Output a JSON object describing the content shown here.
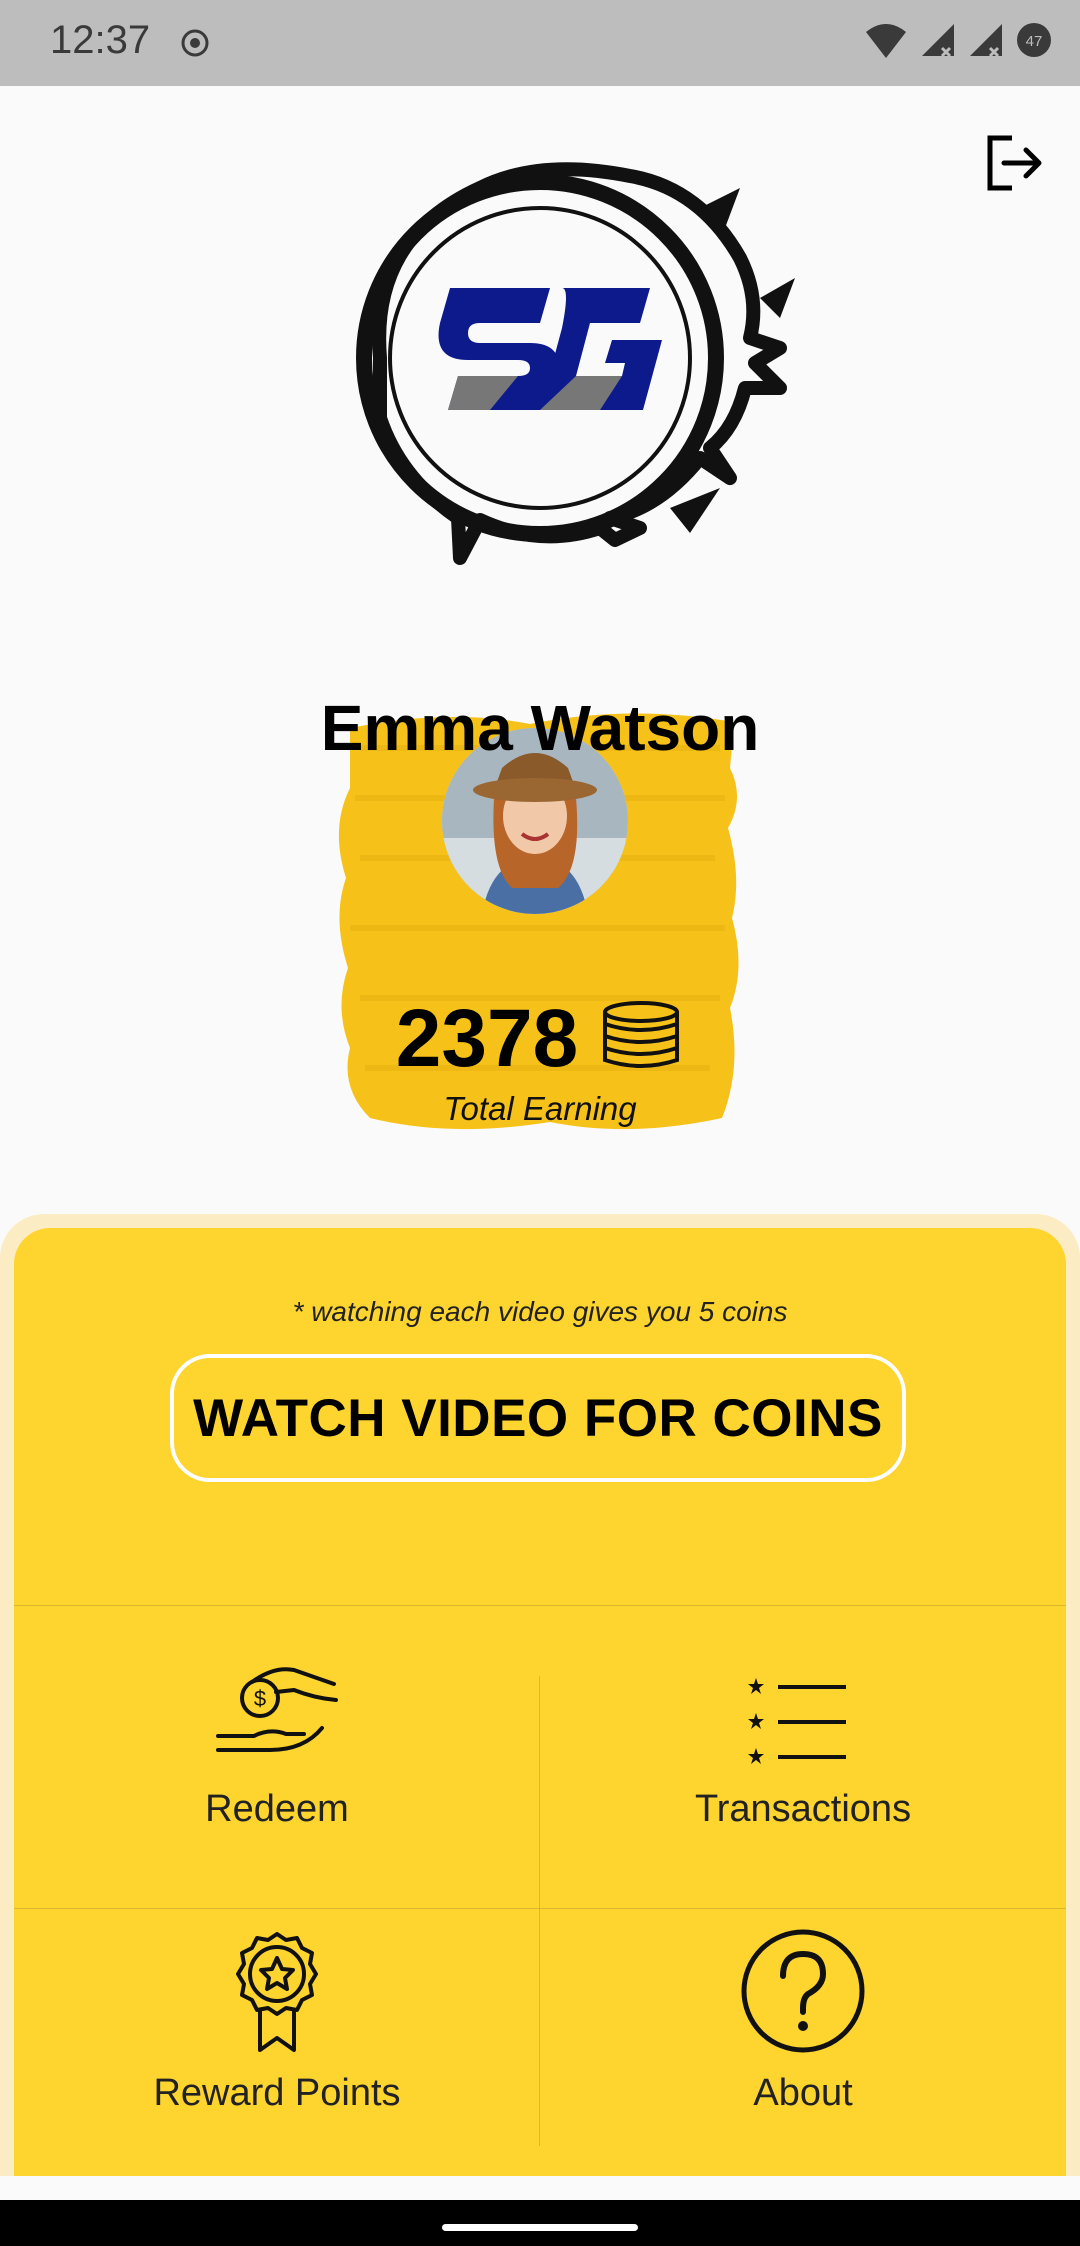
{
  "status": {
    "time": "12:37",
    "battery": "47"
  },
  "header": {
    "logo_text": "SG"
  },
  "profile": {
    "name": "Emma Watson",
    "coins": "2378",
    "total_label": "Total Earning"
  },
  "panel": {
    "hint": "* watching each video gives you 5 coins",
    "watch_button": "WATCH VIDEO FOR COINS",
    "tiles": [
      {
        "label": "Redeem",
        "icon": "hand-coin-icon"
      },
      {
        "label": "Transactions",
        "icon": "star-list-icon"
      },
      {
        "label": "Reward Points",
        "icon": "award-badge-icon"
      },
      {
        "label": "About",
        "icon": "question-circle-icon"
      }
    ]
  },
  "colors": {
    "accent": "#fed42f",
    "panel_border": "#fbecc3",
    "logo_blue": "#0d1a8c"
  }
}
